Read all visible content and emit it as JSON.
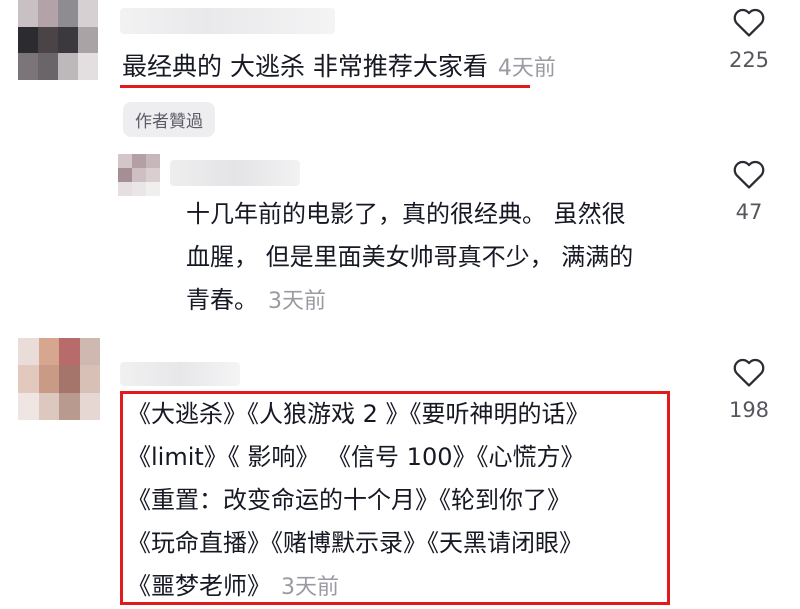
{
  "comments": [
    {
      "text": "最经典的 大逃杀 非常推荐大家看",
      "time": "4天前",
      "likes": "225",
      "badge": "作者贊過",
      "avatar_colors": [
        "#c9c0c3",
        "#b3a3a8",
        "#8f8c91",
        "#d6d0d2",
        "#2c2b2f",
        "#4a4446",
        "#3b393d",
        "#a9a3a5",
        "#7b7478",
        "#6a6569",
        "#bdb8ba",
        "#e3dfe0"
      ]
    },
    {
      "lines": [
        "十几年前的电影了，真的很经典。 虽然很",
        "血腥， 但是里面美女帅哥真不少， 满满的",
        "青春。"
      ],
      "time": "3天前",
      "likes": "47",
      "avatar_colors": [
        "#d2c6c9",
        "#b39fa4",
        "#c7b6ba",
        "#a58f94",
        "#cdbfc2",
        "#d9cfd1",
        "#e6dfe1",
        "#eae5e6",
        "#f1eeee"
      ]
    },
    {
      "lines": [
        "《大逃杀》《人狼游戏 2 》《要听神明的话》",
        "《limit》《 影响》 《信号 100》《心慌方》",
        "《重置：改变命运的十个月》《轮到你了》",
        "《玩命直播》《赌博默示录》《天黑请闭眼》",
        "《噩梦老师》"
      ],
      "time": "3天前",
      "likes": "198",
      "avatar_colors": [
        "#e9dcd9",
        "#d6a68f",
        "#b86b6b",
        "#cfb8b0",
        "#e3c9bd",
        "#c99a86",
        "#a5756c",
        "#d8c0b6",
        "#efe6e3",
        "#dcc8bf",
        "#b89a8e",
        "#e6d7d2"
      ]
    }
  ],
  "colors": {
    "highlight": "#e21a1a",
    "text": "#161823",
    "muted": "#9a9aa2"
  },
  "icons": {
    "like": "heart-outline-icon"
  }
}
